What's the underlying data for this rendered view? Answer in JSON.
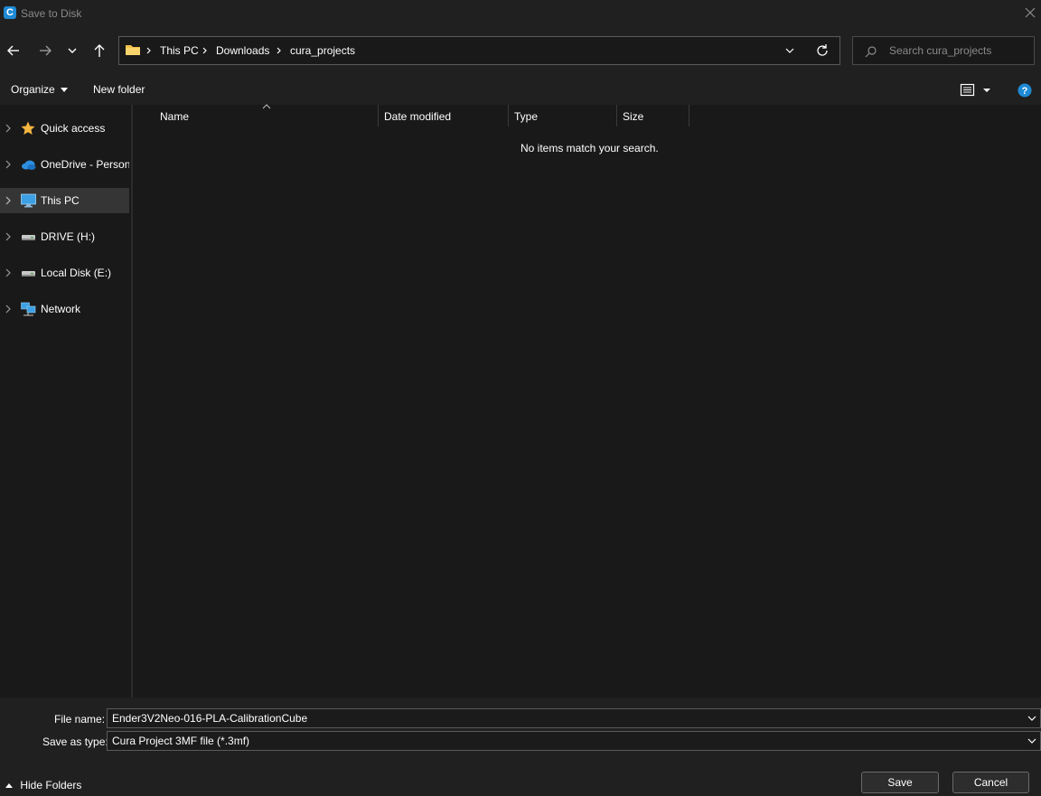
{
  "window": {
    "title": "Save to Disk",
    "app_icon_letter": "C"
  },
  "nav": {
    "back_icon": "arrow-left-icon",
    "forward_icon": "arrow-right-icon",
    "recent_icon": "chevron-down-icon",
    "up_icon": "arrow-up-icon"
  },
  "address": {
    "breadcrumbs": [
      "This PC",
      "Downloads",
      "cura_projects"
    ],
    "refresh_icon": "refresh-icon"
  },
  "search": {
    "placeholder": "Search cura_projects",
    "value": ""
  },
  "toolbar": {
    "organize_label": "Organize",
    "new_folder_label": "New folder",
    "view_icon": "details-view-icon",
    "help_icon": "help-icon",
    "accent_color": "#1e8ad6"
  },
  "sidebar": {
    "items": [
      {
        "label": "Quick access",
        "icon": "star-icon",
        "selected": false
      },
      {
        "label": "OneDrive - Personal",
        "icon": "cloud-icon",
        "selected": false
      },
      {
        "label": "This PC",
        "icon": "computer-icon",
        "selected": true
      },
      {
        "label": "DRIVE (H:)",
        "icon": "drive-icon",
        "selected": false
      },
      {
        "label": "Local Disk (E:)",
        "icon": "drive-icon",
        "selected": false
      },
      {
        "label": "Network",
        "icon": "network-icon",
        "selected": false
      }
    ]
  },
  "filelist": {
    "columns": [
      "Name",
      "Date modified",
      "Type",
      "Size"
    ],
    "sort_column": "Name",
    "empty_message": "No items match your search."
  },
  "footer": {
    "file_name_label": "File name:",
    "file_name_value": "Ender3V2Neo-016-PLA-CalibrationCube",
    "save_type_label": "Save as type:",
    "save_type_value": "Cura Project 3MF file (*.3mf)",
    "hide_folders_label": "Hide Folders",
    "save_label": "Save",
    "cancel_label": "Cancel"
  }
}
